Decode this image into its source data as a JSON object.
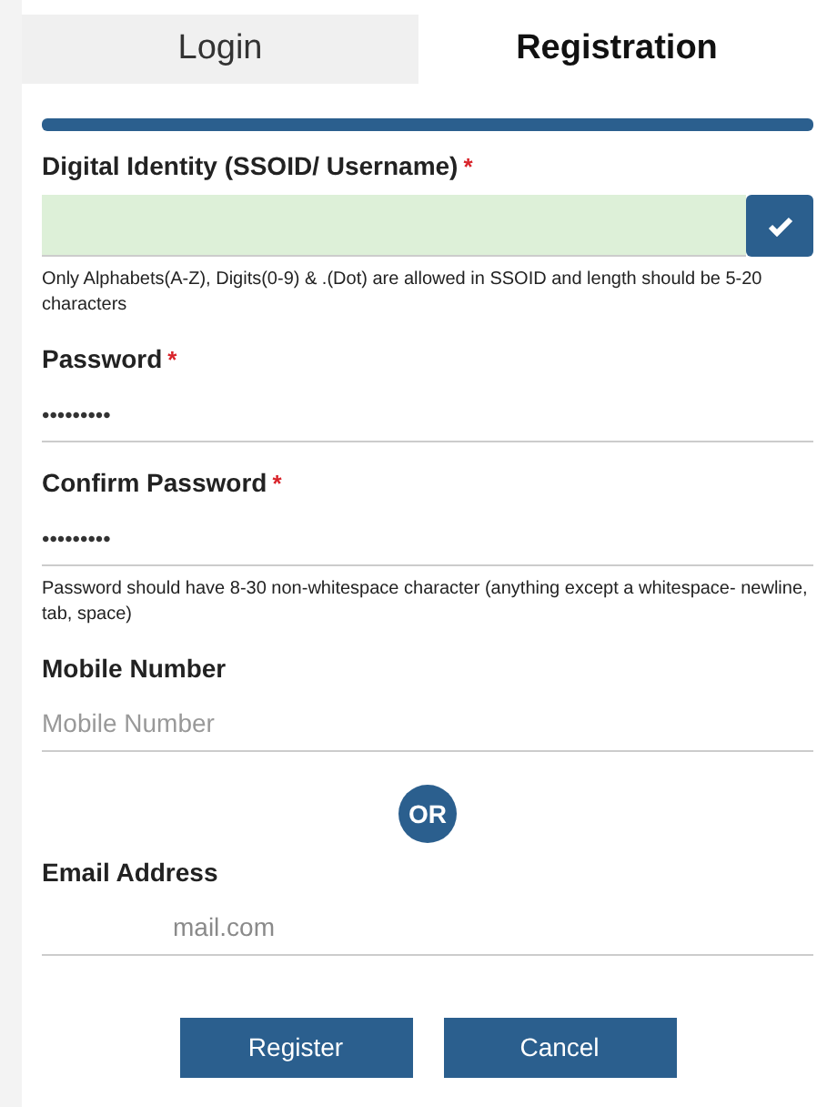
{
  "tabs": [
    {
      "label": "Login",
      "selected": false
    },
    {
      "label": "Registration",
      "selected": true
    }
  ],
  "fields": [
    {
      "kind": "validated",
      "label": "Digital Identity (SSOID/ Username)",
      "required_mark": "*",
      "hint": "Only Alphabets(A-Z), Digits(0-9) & .(Dot) are allowed in SSOID and length should be 5-20 characters"
    },
    {
      "kind": "password",
      "label": "Password",
      "required_mark": "*",
      "value": "•••••••••"
    },
    {
      "kind": "password",
      "label": "Confirm Password",
      "required_mark": "*",
      "value": "•••••••••",
      "hint": "Password should have 8-30 non-whitespace character (anything except a whitespace- newline, tab, space)"
    },
    {
      "kind": "text",
      "label": "Mobile Number",
      "placeholder": "Mobile Number"
    },
    {
      "kind": "separator",
      "text": "OR"
    },
    {
      "kind": "text",
      "label": "Email Address",
      "value": "mail.com"
    }
  ],
  "buttons": [
    "Register",
    "Cancel"
  ]
}
